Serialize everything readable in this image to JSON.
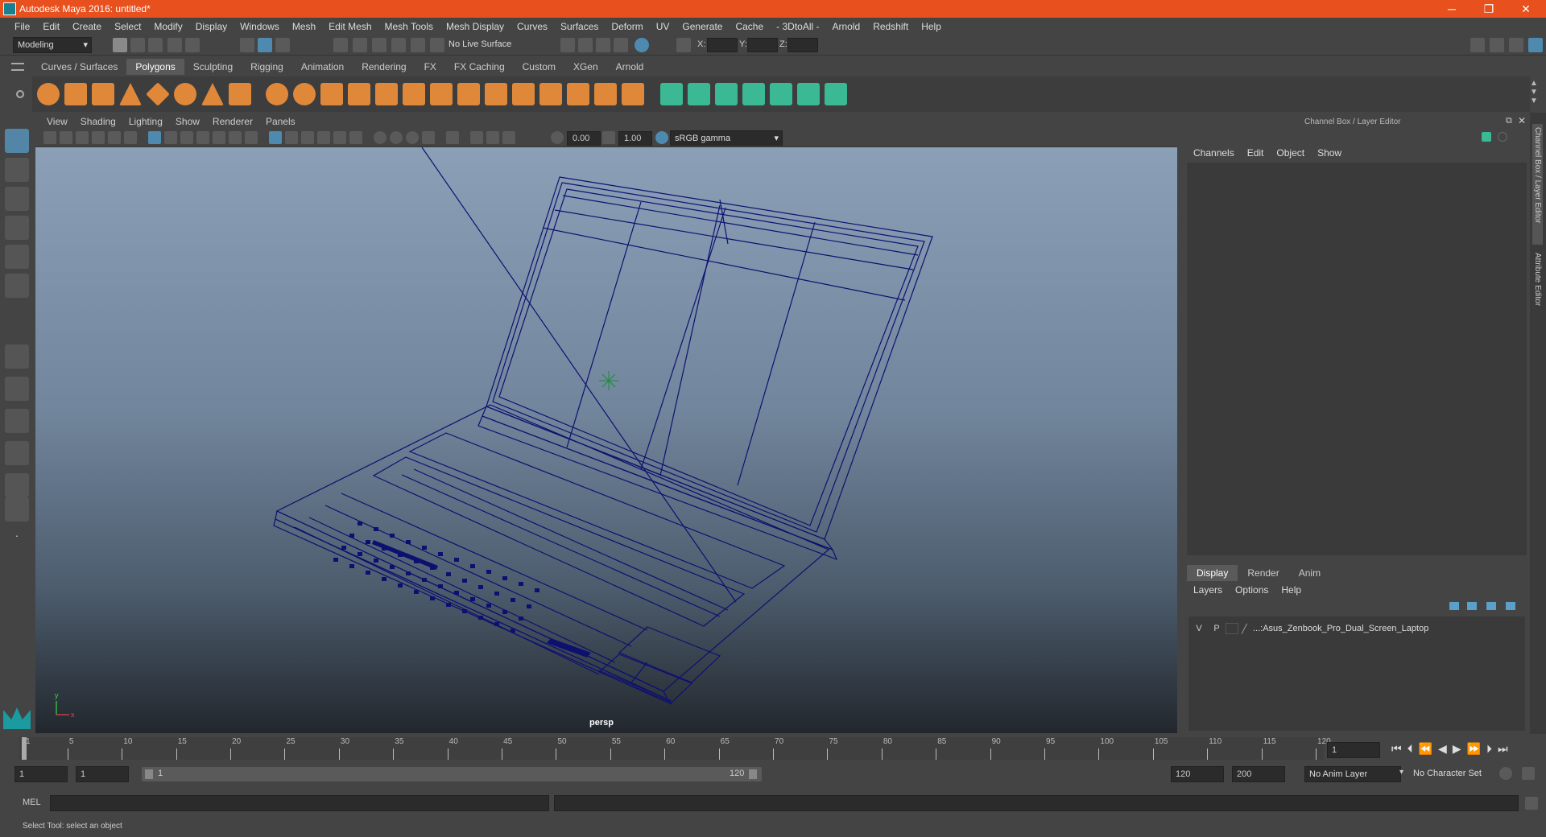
{
  "window": {
    "title": "Autodesk Maya 2016: untitled*",
    "controls": [
      "─",
      "❐",
      "✕"
    ]
  },
  "menubar": [
    "File",
    "Edit",
    "Create",
    "Select",
    "Modify",
    "Display",
    "Windows",
    "Mesh",
    "Edit Mesh",
    "Mesh Tools",
    "Mesh Display",
    "Curves",
    "Surfaces",
    "Deform",
    "UV",
    "Generate",
    "Cache",
    "- 3DtoAll -",
    "Arnold",
    "Redshift",
    "Help"
  ],
  "statusline": {
    "mode": "Modeling",
    "live_surface": "No Live Surface",
    "x_label": "X:",
    "y_label": "Y:",
    "z_label": "Z:"
  },
  "shelf": {
    "tabs": [
      "Curves / Surfaces",
      "Polygons",
      "Sculpting",
      "Rigging",
      "Animation",
      "Rendering",
      "FX",
      "FX Caching",
      "Custom",
      "XGen",
      "Arnold"
    ],
    "active_tab": "Polygons"
  },
  "viewport": {
    "menu": [
      "View",
      "Shading",
      "Lighting",
      "Show",
      "Renderer",
      "Panels"
    ],
    "exposure": "0.00",
    "gamma": "1.00",
    "color_space": "sRGB gamma",
    "camera_label": "persp",
    "axis_x": "x",
    "axis_y": "y"
  },
  "channel_box": {
    "title": "Channel Box / Layer Editor",
    "menu": [
      "Channels",
      "Edit",
      "Object",
      "Show"
    ]
  },
  "layer_editor": {
    "tabs": [
      "Display",
      "Render",
      "Anim"
    ],
    "active_tab": "Display",
    "menu": [
      "Layers",
      "Options",
      "Help"
    ],
    "layers": [
      {
        "v": "V",
        "p": "P",
        "name": "...:Asus_Zenbook_Pro_Dual_Screen_Laptop"
      }
    ]
  },
  "side_tabs": [
    "Channel Box / Layer Editor",
    "Attribute Editor"
  ],
  "timeline": {
    "ticks": [
      "1",
      "5",
      "10",
      "15",
      "20",
      "25",
      "30",
      "35",
      "40",
      "45",
      "50",
      "55",
      "60",
      "65",
      "70",
      "75",
      "80",
      "85",
      "90",
      "95",
      "100",
      "105",
      "110",
      "115",
      "120"
    ],
    "current_frame": "1"
  },
  "range": {
    "start": "1",
    "playback_start": "1",
    "slider_start": "1",
    "slider_end": "120",
    "playback_end": "120",
    "end": "200",
    "anim_layer": "No Anim Layer",
    "character_set": "No Character Set"
  },
  "command_line": {
    "label": "MEL"
  },
  "help_line": {
    "text": "Select Tool: select an object"
  }
}
